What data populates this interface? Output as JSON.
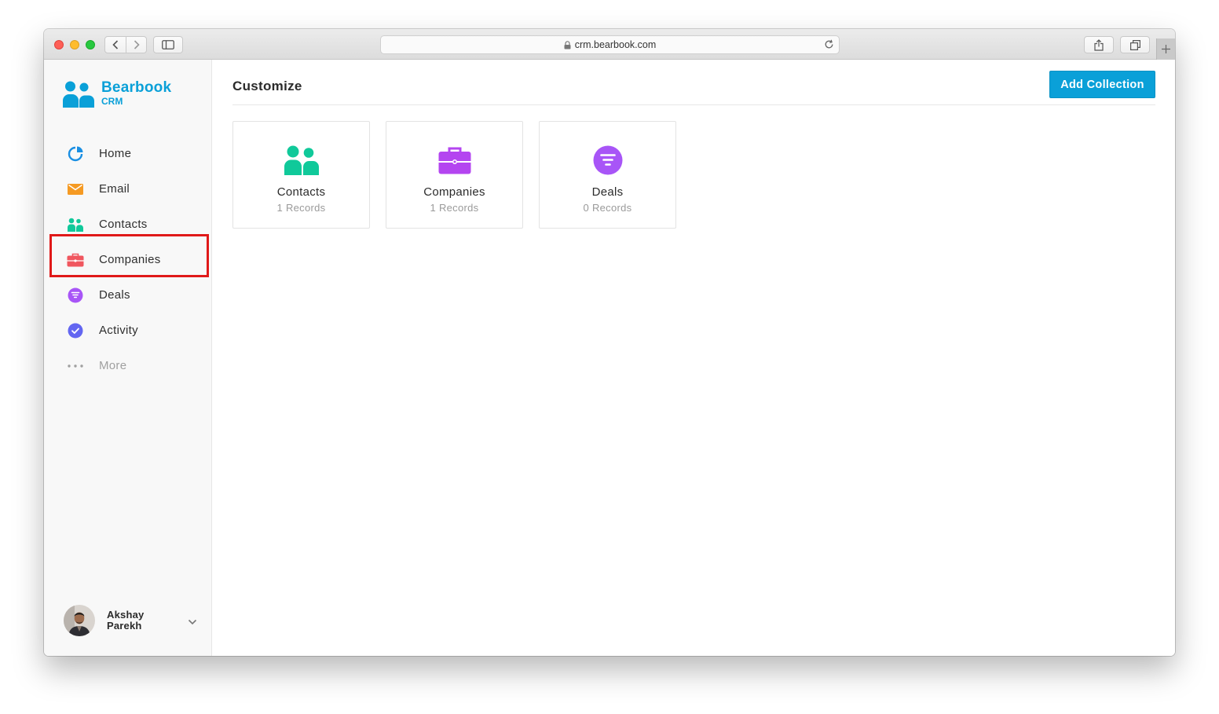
{
  "browser": {
    "url": "crm.bearbook.com",
    "icons": [
      "back-icon",
      "forward-icon",
      "sidebar-toggle-icon",
      "lock-icon",
      "reload-icon",
      "share-icon",
      "tabs-icon",
      "new-tab-icon"
    ]
  },
  "brand": {
    "name": "Bearbook",
    "subtitle": "CRM",
    "color": "#0aa0d8"
  },
  "sidebar": {
    "items": [
      {
        "label": "Home",
        "icon": "pie-chart-icon",
        "color": "#1a8fe3"
      },
      {
        "label": "Email",
        "icon": "envelope-icon",
        "color": "#f59a23"
      },
      {
        "label": "Contacts",
        "icon": "people-icon",
        "color": "#10c99a",
        "highlighted": true
      },
      {
        "label": "Companies",
        "icon": "briefcase-icon",
        "color": "#f0565e"
      },
      {
        "label": "Deals",
        "icon": "funnel-icon",
        "color": "#a855f7"
      },
      {
        "label": "Activity",
        "icon": "check-circle-icon",
        "color": "#6366f1"
      },
      {
        "label": "More",
        "icon": "more-dots-icon",
        "color": "#a0a0a0"
      }
    ]
  },
  "user": {
    "first_name": "Akshay",
    "last_name": "Parekh"
  },
  "main": {
    "title": "Customize",
    "add_button": "Add Collection",
    "cards": [
      {
        "title": "Contacts",
        "count": "1 Records",
        "icon": "people-icon",
        "color": "#10c99a"
      },
      {
        "title": "Companies",
        "count": "1 Records",
        "icon": "briefcase-icon",
        "color": "#b445f0"
      },
      {
        "title": "Deals",
        "count": "0 Records",
        "icon": "funnel-icon",
        "color": "#a855f7"
      }
    ]
  },
  "highlight_color": "#e01919"
}
